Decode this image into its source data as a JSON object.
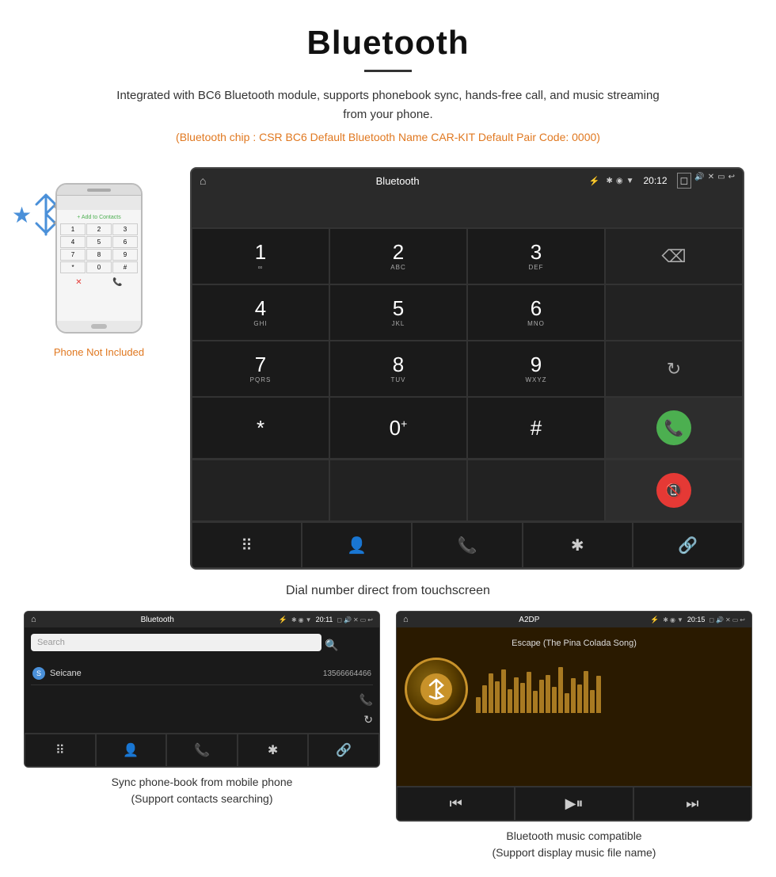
{
  "header": {
    "title": "Bluetooth",
    "description": "Integrated with BC6 Bluetooth module, supports phonebook sync, hands-free call, and music streaming from your phone.",
    "specs": "(Bluetooth chip : CSR BC6    Default Bluetooth Name CAR-KIT    Default Pair Code: 0000)"
  },
  "phone_label": "Phone Not Included",
  "dialpad_screen": {
    "app_title": "Bluetooth",
    "time": "20:12",
    "keys": [
      {
        "digit": "1",
        "sub": "∞"
      },
      {
        "digit": "2",
        "sub": "ABC"
      },
      {
        "digit": "3",
        "sub": "DEF"
      },
      {
        "digit": "⌫",
        "sub": "",
        "type": "backspace"
      },
      {
        "digit": "4",
        "sub": "GHI"
      },
      {
        "digit": "5",
        "sub": "JKL"
      },
      {
        "digit": "6",
        "sub": "MNO"
      },
      {
        "digit": "",
        "sub": "",
        "type": "empty"
      },
      {
        "digit": "7",
        "sub": "PQRS"
      },
      {
        "digit": "8",
        "sub": "TUV"
      },
      {
        "digit": "9",
        "sub": "WXYZ"
      },
      {
        "digit": "↻",
        "sub": "",
        "type": "refresh"
      },
      {
        "digit": "*",
        "sub": ""
      },
      {
        "digit": "0",
        "sub": "+"
      },
      {
        "digit": "#",
        "sub": ""
      }
    ],
    "footer_icons": [
      "⠿",
      "👤",
      "📞",
      "✱",
      "🔗"
    ]
  },
  "dialpad_caption": "Dial number direct from touchscreen",
  "phonebook_screen": {
    "app_title": "Bluetooth",
    "time": "20:11",
    "search_placeholder": "Search",
    "contact": {
      "letter": "S",
      "name": "Seicane",
      "phone": "13566664466"
    }
  },
  "phonebook_caption": "Sync phone-book from mobile phone\n(Support contacts searching)",
  "music_screen": {
    "app_title": "A2DP",
    "time": "20:15",
    "song_title": "Escape (The Pina Colada Song)",
    "viz_heights": [
      20,
      35,
      50,
      40,
      55,
      30,
      45,
      38,
      52,
      28,
      42,
      48,
      33,
      58,
      25,
      44,
      36,
      53,
      29,
      47
    ]
  },
  "music_caption": "Bluetooth music compatible\n(Support display music file name)"
}
